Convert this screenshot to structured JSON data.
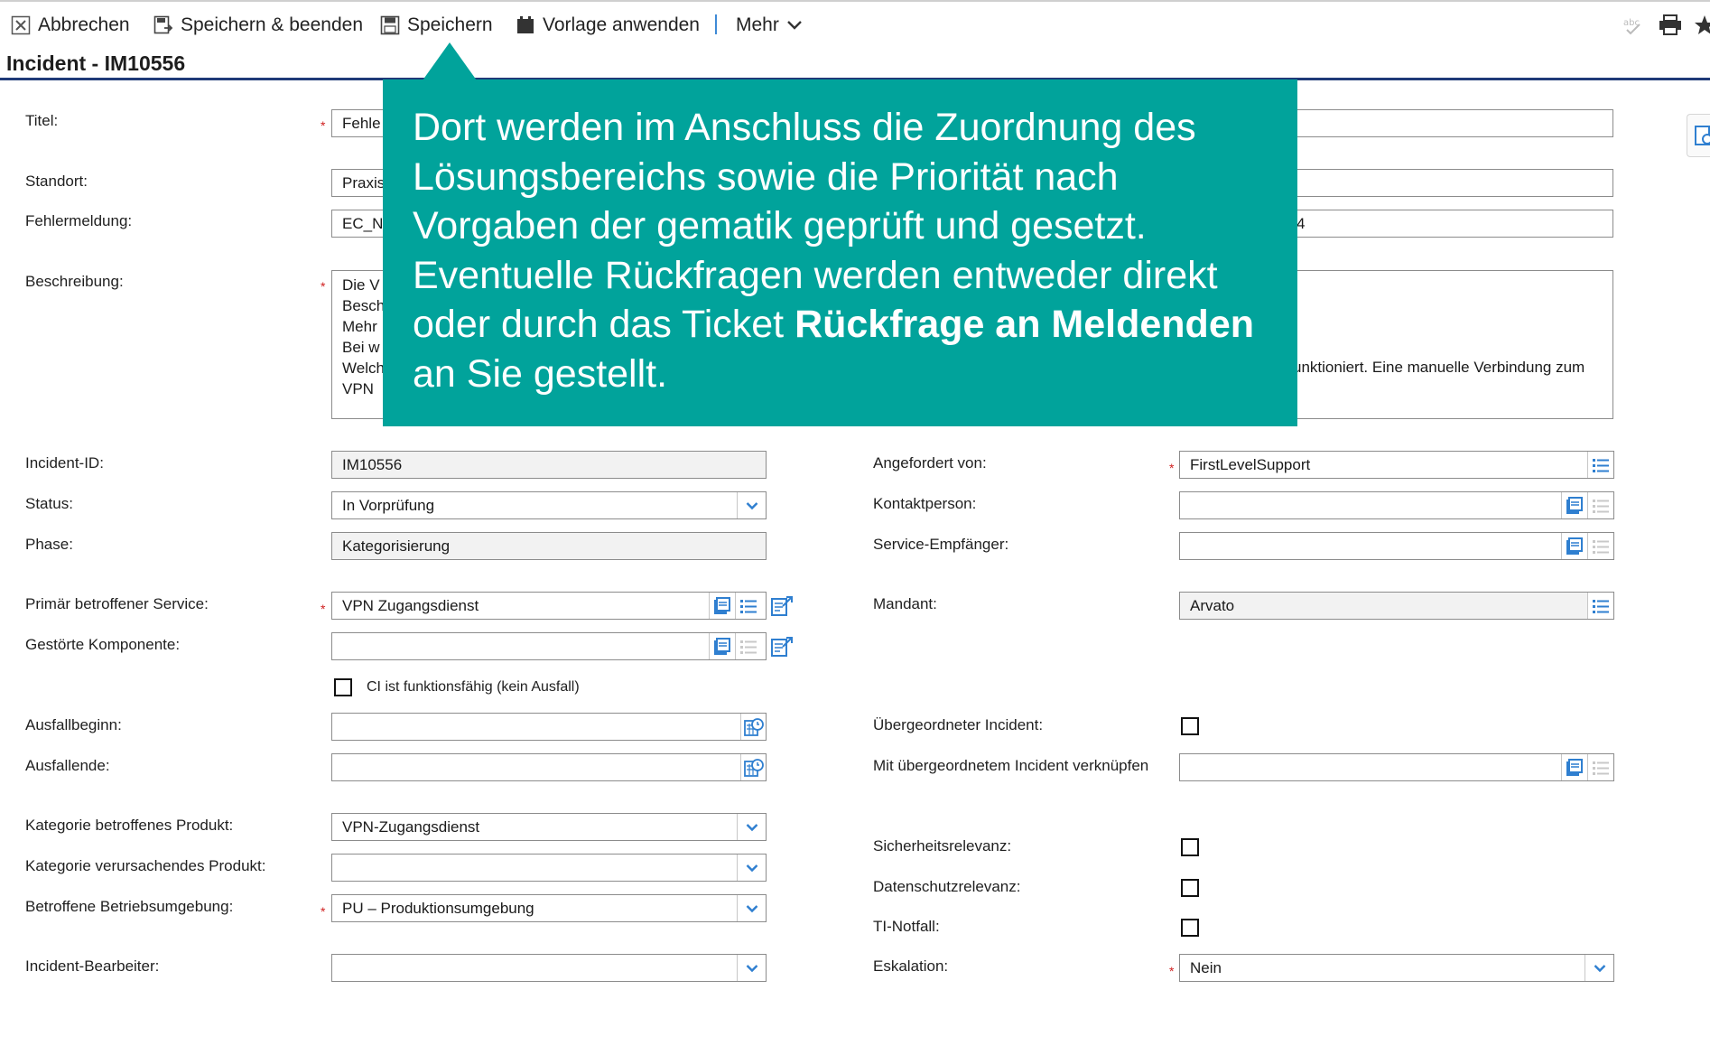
{
  "toolbar": {
    "cancel": "Abbrechen",
    "save_close": "Speichern & beenden",
    "save": "Speichern",
    "apply_template": "Vorlage anwenden",
    "more": "Mehr"
  },
  "window_title": "Incident - IM10556",
  "callout": {
    "text_before": "Dort werden im Anschluss die Zuordnung des Lösungsbereichs sowie die Priorität nach Vorgaben der gematik geprüft und gesetzt. Eventuelle Rückfragen werden entweder direkt oder durch das Ticket ",
    "text_bold": "Rückfrage an Meldenden",
    "text_after": " an Sie gestellt."
  },
  "form": {
    "title": {
      "label": "Titel:",
      "value": "Fehle"
    },
    "location": {
      "label": "Standort:",
      "value": "Praxis"
    },
    "error_message": {
      "label": "Fehlermeldung:",
      "value": "EC_N",
      "value_end": "4"
    },
    "description": {
      "label": "Beschreibung:",
      "lines": [
        "Die V",
        "Besch",
        "Mehr",
        "Bei w",
        "Welch",
        "VPN"
      ],
      "line5_end": "unktioniert. Eine manuelle Verbindung zum"
    },
    "incident_id": {
      "label": "Incident-ID:",
      "value": "IM10556"
    },
    "status": {
      "label": "Status:",
      "value": "In Vorprüfung"
    },
    "phase": {
      "label": "Phase:",
      "value": "Kategorisierung"
    },
    "primary_service": {
      "label": "Primär betroffener Service:",
      "value": "VPN Zugangsdienst"
    },
    "failed_component": {
      "label": "Gestörte Komponente:",
      "value": ""
    },
    "ci_functional": {
      "label": "CI ist funktionsfähig (kein Ausfall)",
      "checked": false
    },
    "outage_start": {
      "label": "Ausfallbeginn:",
      "value": ""
    },
    "outage_end": {
      "label": "Ausfallende:",
      "value": ""
    },
    "category_product": {
      "label": "Kategorie betroffenes Produkt:",
      "value": "VPN-Zugangsdienst"
    },
    "category_cause_product": {
      "label": "Kategorie verursachendes Produkt:",
      "value": ""
    },
    "environment": {
      "label": "Betroffene Betriebsumgebung:",
      "value": "PU – Produktionsumgebung"
    },
    "assignee": {
      "label": "Incident-Bearbeiter:",
      "value": ""
    },
    "requested_by": {
      "label": "Angefordert von:",
      "value": "FirstLevelSupport"
    },
    "contact": {
      "label": "Kontaktperson:",
      "value": ""
    },
    "service_recipient": {
      "label": "Service-Empfänger:",
      "value": ""
    },
    "client": {
      "label": "Mandant:",
      "value": "Arvato"
    },
    "parent_incident": {
      "label": "Übergeordneter Incident:",
      "checked": false
    },
    "link_parent": {
      "label": "Mit übergeordnetem Incident verknüpfen",
      "value": ""
    },
    "security": {
      "label": "Sicherheitsrelevanz:",
      "checked": false
    },
    "privacy": {
      "label": "Datenschutzrelevanz:",
      "checked": false
    },
    "ti_emergency": {
      "label": "TI-Notfall:",
      "checked": false
    },
    "escalation": {
      "label": "Eskalation:",
      "value": "Nein"
    }
  },
  "colors": {
    "callout": "#01a39b",
    "title_underline": "#1f3a78",
    "icon_blue": "#2f7fd0",
    "required": "#d02020"
  }
}
